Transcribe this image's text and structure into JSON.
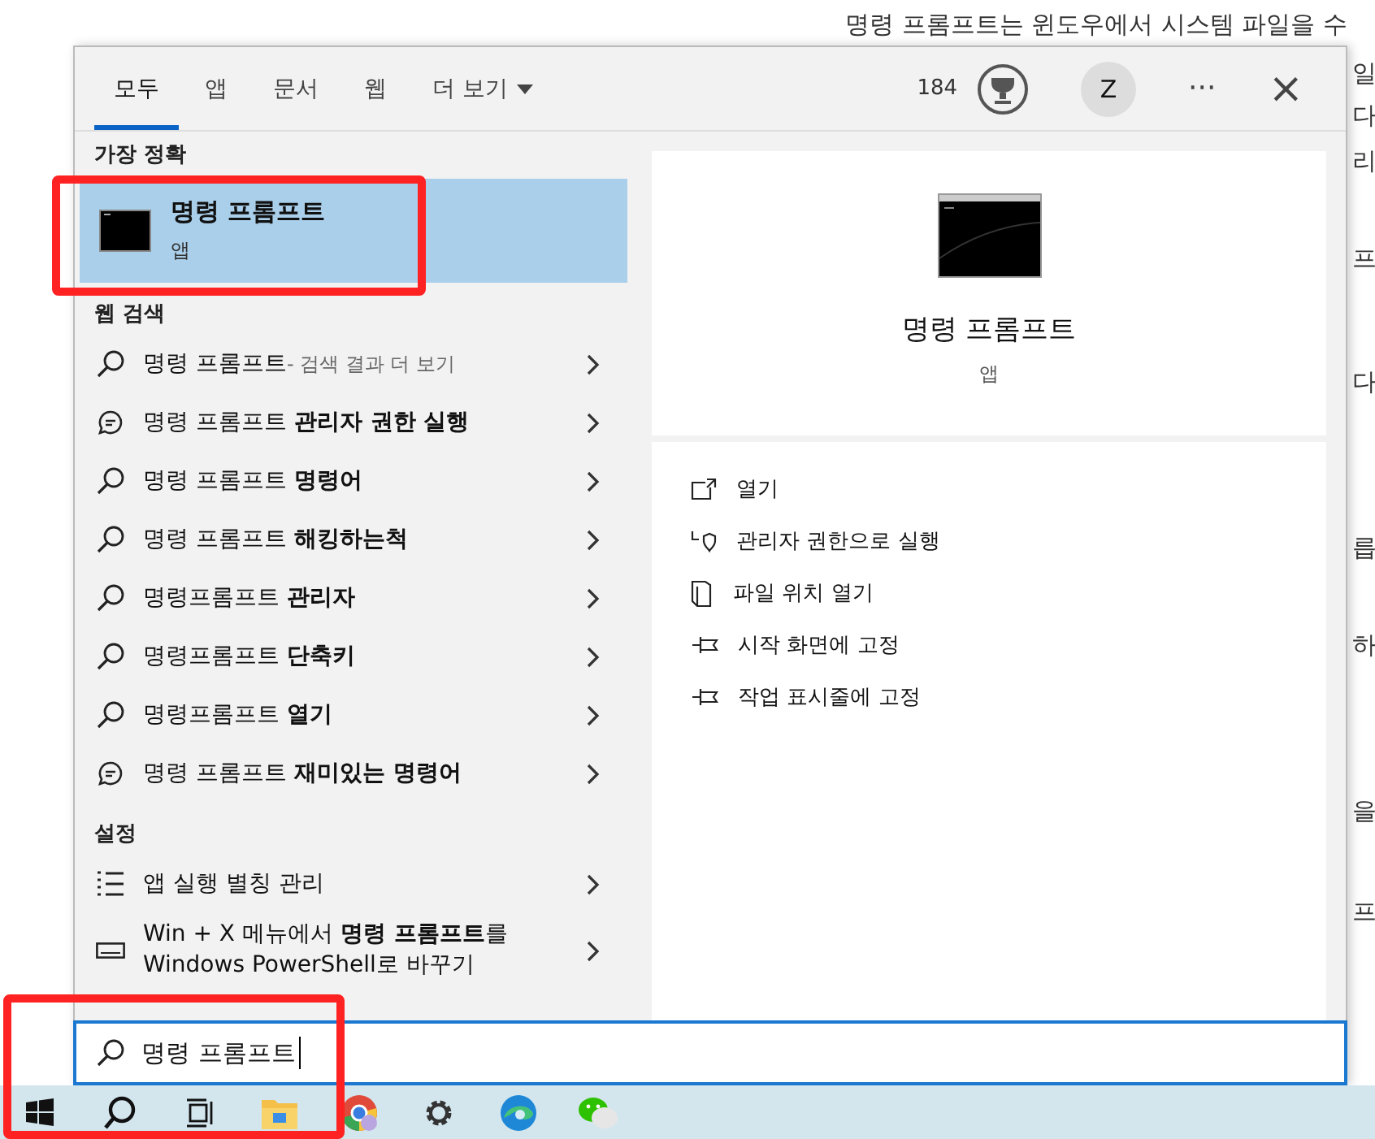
{
  "background_article": {
    "lines": [
      "명령 프롬프트는 윈도우에서 시스템 파일을 수",
      "일",
      "다",
      "리",
      "프",
      "다",
      "릅",
      "하",
      "을",
      "프"
    ]
  },
  "tabs": [
    {
      "label": "모두",
      "selected": true
    },
    {
      "label": "앱",
      "selected": false
    },
    {
      "label": "문서",
      "selected": false
    },
    {
      "label": "웹",
      "selected": false
    },
    {
      "label": "더 보기",
      "selected": false,
      "kind": "dropdown"
    }
  ],
  "header_right": {
    "points": "184",
    "avatar": "Z",
    "more": "···",
    "close": "×"
  },
  "best_match": {
    "heading": "가장 정확",
    "title": "명령 프롬프트",
    "subtitle": "앱",
    "selected": true
  },
  "sections": [
    {
      "heading": "웹 검색",
      "items": [
        {
          "kind": "search",
          "text": "명령 프롬프트",
          "suffix": "- 검색 결과 더 보기"
        },
        {
          "kind": "chat",
          "text": "명령 프롬프트 **관리자 권한 실행**"
        },
        {
          "kind": "search",
          "text": "명령 프롬프트 **명령어**"
        },
        {
          "kind": "search",
          "text": "명령 프롬프트 **해킹하는척**"
        },
        {
          "kind": "search",
          "text": "명령프롬프트 **관리자**"
        },
        {
          "kind": "search",
          "text": "명령프롬프트 **단축키**"
        },
        {
          "kind": "search",
          "text": "명령프롬프트 **열기**"
        },
        {
          "kind": "chat",
          "text": "명령 프롬프트 **재미있는 명령어**"
        }
      ]
    },
    {
      "heading": "설정",
      "items": [
        {
          "kind": "list",
          "text": "앱 실행 별칭 관리"
        },
        {
          "kind": "keyboard",
          "text": "Win + X 메뉴에서 **명령 프롬프트**를 Windows PowerShell로 바꾸기"
        }
      ]
    }
  ],
  "preview": {
    "title": "명령 프롬프트",
    "subtitle": "앱",
    "actions": [
      {
        "kind": "open",
        "label": "열기"
      },
      {
        "kind": "admin",
        "label": "관리자 권한으로 실행"
      },
      {
        "kind": "folder",
        "label": "파일 위치 열기"
      },
      {
        "kind": "pin",
        "label": "시작 화면에 고정"
      },
      {
        "kind": "pin",
        "label": "작업 표시줄에 고정"
      }
    ]
  },
  "search": {
    "value": "명령 프롬프트"
  },
  "taskbar": [
    {
      "kind": "start"
    },
    {
      "kind": "search"
    },
    {
      "kind": "taskview"
    },
    {
      "kind": "folder"
    },
    {
      "kind": "browser"
    },
    {
      "kind": "settings"
    },
    {
      "kind": "edge"
    },
    {
      "kind": "chat"
    }
  ]
}
